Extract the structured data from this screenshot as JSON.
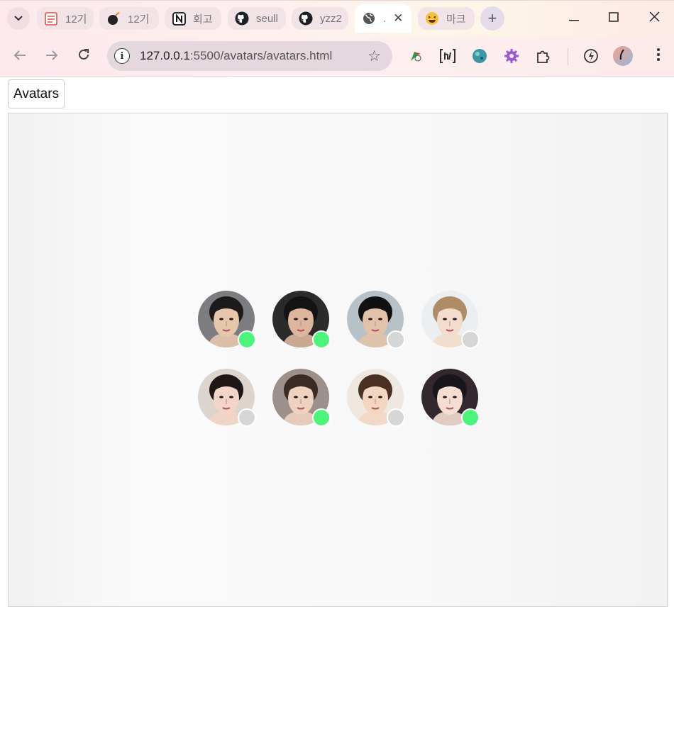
{
  "browser": {
    "tabs": [
      {
        "title": "12기",
        "icon": "notepad-icon"
      },
      {
        "title": "12기",
        "icon": "bomb-icon"
      },
      {
        "title": "회고",
        "icon": "notion-icon"
      },
      {
        "title": "seull",
        "icon": "github-icon"
      },
      {
        "title": "yzz2",
        "icon": "github-icon"
      },
      {
        "title": ".",
        "icon": "globe-icon",
        "active": true
      },
      {
        "title": "마크",
        "icon": "laughing-emoji-icon"
      }
    ],
    "url_host": "127.0.0.1",
    "url_rest": ":5500/avatars/avatars.html"
  },
  "page": {
    "title_button": "Avatars"
  },
  "colors": {
    "online": "#4cf47a",
    "offline": "#d6d6d6"
  },
  "avatars": [
    {
      "status": "online",
      "skin": "#e6c7ac",
      "hair": "#1c1a1a",
      "bg": "#7b7d80"
    },
    {
      "status": "online",
      "skin": "#dcb79d",
      "hair": "#141414",
      "bg": "#2b2b2b"
    },
    {
      "status": "offline",
      "skin": "#e2c3a9",
      "hair": "#111111",
      "bg": "#b7c2c8"
    },
    {
      "status": "offline",
      "skin": "#f3dccb",
      "hair": "#b08b68",
      "bg": "#eceff2"
    },
    {
      "status": "offline",
      "skin": "#f2d5c6",
      "hair": "#1d1717",
      "bg": "#ddd4cd"
    },
    {
      "status": "online",
      "skin": "#eed1bf",
      "hair": "#3a2b24",
      "bg": "#9d8f8a"
    },
    {
      "status": "offline",
      "skin": "#f3d6c2",
      "hair": "#4a2f22",
      "bg": "#efe8e0"
    },
    {
      "status": "online",
      "skin": "#f5ddd2",
      "hair": "#18161a",
      "bg": "#32282e"
    }
  ]
}
